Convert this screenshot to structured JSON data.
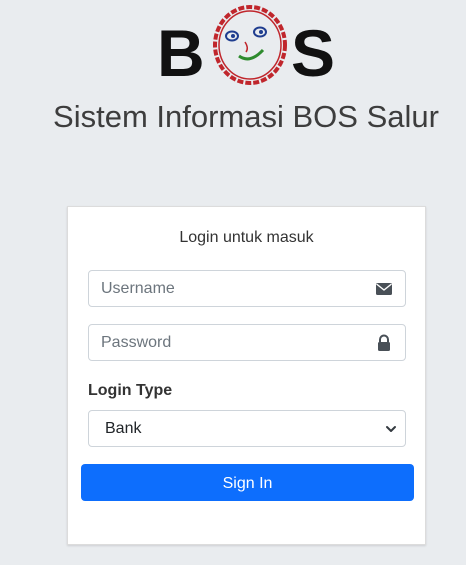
{
  "logo": {
    "letters_left": "B",
    "letters_right": "S",
    "face_icon": "smiley-face-logo"
  },
  "app": {
    "title": "Sistem Informasi BOS Salur"
  },
  "login_card": {
    "message": "Login untuk masuk",
    "username": {
      "placeholder": "Username",
      "value": "",
      "icon": "envelope-icon"
    },
    "password": {
      "placeholder": "Password",
      "value": "",
      "icon": "lock-icon"
    },
    "login_type": {
      "label": "Login Type",
      "selected": "Bank",
      "icon": "chevron-down-icon"
    },
    "submit_label": "Sign In"
  },
  "colors": {
    "background": "#e9ecef",
    "primary": "#0d6efd",
    "logo_red": "#c0262c",
    "logo_blue": "#1f3d8f",
    "logo_green": "#2e8b2e"
  }
}
